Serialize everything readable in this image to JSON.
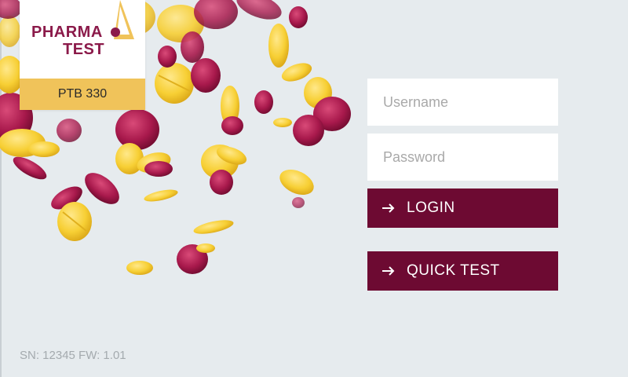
{
  "brand": {
    "name_line1": "PHARMA",
    "name_line2": "TEST",
    "model": "PTB 330",
    "primary_color": "#6d0a32",
    "accent_color": "#f0c35a"
  },
  "form": {
    "username_placeholder": "Username",
    "password_placeholder": "Password",
    "login_label": "LOGIN",
    "quick_test_label": "QUICK TEST",
    "button_icon": "arrow-right-icon"
  },
  "footer": {
    "device_info": "SN: 12345 FW: 1.01"
  }
}
